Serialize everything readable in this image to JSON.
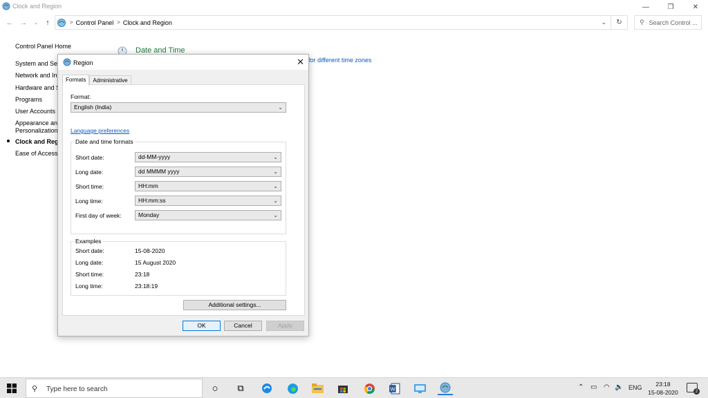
{
  "window": {
    "title": "Clock and Region",
    "controls": {
      "minimize": "—",
      "maximize": "❐",
      "close": "✕"
    }
  },
  "address": {
    "nav_back": "←",
    "nav_forward": "→",
    "nav_recent": "⌄",
    "nav_up": "↑",
    "separator": ">",
    "crumbs": [
      "Control Panel",
      "Clock and Region"
    ],
    "dropdown": "⌄",
    "refresh": "↻",
    "search_icon": "⚲",
    "search_placeholder": "Search Control ..."
  },
  "leftnav": {
    "items": [
      "Control Panel Home",
      "System and Sec",
      "Network and Int",
      "Hardware and S",
      "Programs",
      "User Accounts",
      "Appearance and",
      "Personalization",
      "Clock and Regio",
      "Ease of Access"
    ]
  },
  "main": {
    "heading": "Date and Time",
    "link": "for different time zones"
  },
  "dialog": {
    "title": "Region",
    "close": "✕",
    "tabs": [
      "Formats",
      "Administrative"
    ],
    "format_label": "Format:",
    "format_value": "English (India)",
    "chevron": "⌄",
    "language_link": "Language preferences",
    "dt_group_title": "Date and time formats",
    "dt_rows": [
      {
        "label": "Short date:",
        "value": "dd-MM-yyyy"
      },
      {
        "label": "Long date:",
        "value": "dd MMMM yyyy"
      },
      {
        "label": "Short time:",
        "value": "HH:mm"
      },
      {
        "label": "Long time:",
        "value": "HH:mm:ss"
      },
      {
        "label": "First day of week:",
        "value": "Monday"
      }
    ],
    "examples_title": "Examples",
    "examples": [
      {
        "label": "Short date:",
        "value": "15-08-2020"
      },
      {
        "label": "Long date:",
        "value": "15 August 2020"
      },
      {
        "label": "Short time:",
        "value": "23:18"
      },
      {
        "label": "Long time:",
        "value": "23:18:19"
      }
    ],
    "additional_settings": "Additional settings...",
    "ok": "OK",
    "cancel": "Cancel",
    "apply": "Apply"
  },
  "taskbar": {
    "search_placeholder": "Type here to search",
    "search_icon": "⚲",
    "cortana": "○",
    "task_view": "⧉",
    "tray_up": "⌃",
    "tray_power": "▭",
    "tray_network": "◠",
    "tray_volume": "🔈",
    "language": "ENG",
    "time": "23:18",
    "date": "15-08-2020",
    "notifications": "2"
  },
  "colors": {
    "accent": "#0078d7",
    "link": "#0a5cb8",
    "heading_green": "#1e7a3c"
  }
}
